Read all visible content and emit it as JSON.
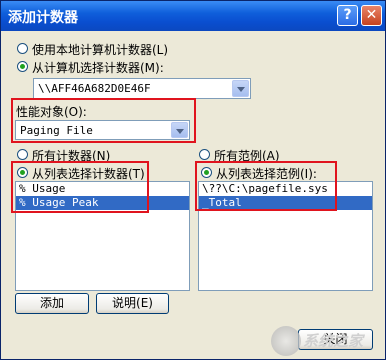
{
  "window": {
    "title": "添加计数器",
    "help_glyph": "?",
    "close_glyph": "✕"
  },
  "source": {
    "local_label": "使用本地计算机计数器(L)",
    "remote_label": "从计算机选择计数器(M):",
    "computer_value": "\\\\AFF46A682D0E46F"
  },
  "object": {
    "label": "性能对象(O):",
    "value": "Paging File"
  },
  "counters": {
    "all_label": "所有计数器(N)",
    "select_label": "从列表选择计数器(T)",
    "items": [
      "% Usage",
      "% Usage Peak"
    ]
  },
  "instances": {
    "all_label": "所有范例(A)",
    "select_label": "从列表选择范例(I):",
    "items": [
      "\\??\\C:\\pagefile.sys",
      "_Total"
    ]
  },
  "buttons": {
    "add": "添加",
    "explain": "说明(E)",
    "close": "关闭"
  },
  "watermark": {
    "text": "系统之家"
  },
  "colors": {
    "highlight": "#316AC5",
    "annotation": "#E0141E",
    "titlebar": "#0A4ED0"
  }
}
